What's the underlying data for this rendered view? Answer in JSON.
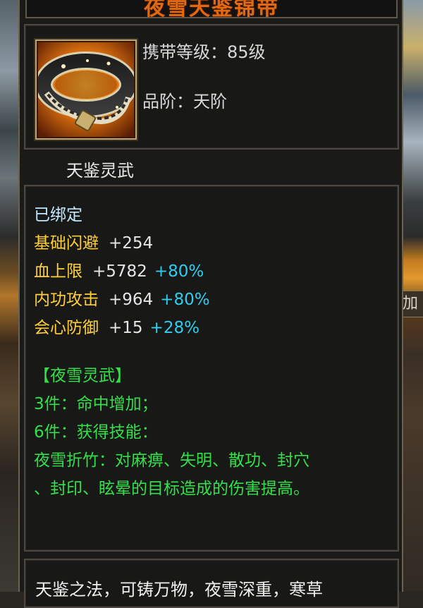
{
  "title": "夜雪天鉴锦带",
  "item": {
    "icon": "belt-icon",
    "level": "携带等级：85级",
    "grade": "品阶：天阶"
  },
  "category": "天鉴灵武",
  "bound": "已绑定",
  "stats": [
    {
      "name": "基础闪避",
      "value": "+254",
      "pct": ""
    },
    {
      "name": "血上限",
      "value": "+5782",
      "pct": "+80%"
    },
    {
      "name": "内功攻击",
      "value": "+964",
      "pct": "+80%"
    },
    {
      "name": "会心防御",
      "value": "+15",
      "pct": "+28%"
    }
  ],
  "set": {
    "name": "【夜雪灵武】",
    "bonus3": "3件：命中增加；",
    "bonus6": "6件：获得技能：",
    "skill_line1": "夜雪折竹：对麻痹、失明、散功、封穴",
    "skill_line2": "、封印、眩晕的目标造成的伤害提高。"
  },
  "lore": "天鉴之法，可铸万物，夜雪深重，寒草",
  "side_text": "加",
  "colors": {
    "title": "#e06a14",
    "stat_name": "#ffcf3a",
    "stat_pct": "#2fcdf0",
    "set_text": "#33e04a",
    "bound": "#bfe8ff"
  }
}
